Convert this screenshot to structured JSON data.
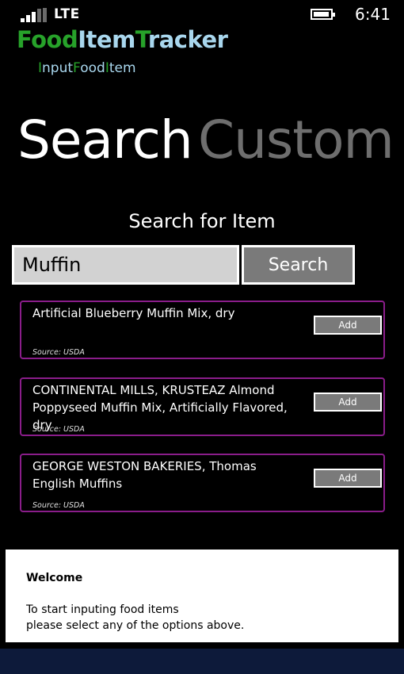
{
  "status_bar": {
    "network": "LTE",
    "time": "6:41",
    "signal_bars_filled": 3,
    "signal_bars_total": 5
  },
  "app": {
    "title_parts": [
      {
        "text": "Food",
        "color": "#27a22a"
      },
      {
        "text": "Item",
        "color": "#a9d7ee"
      },
      {
        "text": "T",
        "color": "#27a22a"
      },
      {
        "text": "racker",
        "color": "#a9d7ee"
      }
    ],
    "subtitle_parts": [
      {
        "text": "I",
        "color": "#27a22a"
      },
      {
        "text": "nput",
        "color": "#a9d7ee"
      },
      {
        "text": "F",
        "color": "#27a22a"
      },
      {
        "text": "ood",
        "color": "#a9d7ee"
      },
      {
        "text": "I",
        "color": "#27a22a"
      },
      {
        "text": "tem",
        "color": "#a9d7ee"
      }
    ]
  },
  "pivot": {
    "active": "Search",
    "inactive": "Custom"
  },
  "search": {
    "label": "Search for Item",
    "value": "Muffin",
    "button": "Search"
  },
  "results": [
    {
      "name": "Artificial Blueberry Muffin Mix, dry",
      "source": "Source: USDA",
      "add_label": "Add"
    },
    {
      "name": "CONTINENTAL MILLS, KRUSTEAZ Almond Poppyseed Muffin Mix, Artificially Flavored, dry",
      "source": "Source: USDA",
      "add_label": "Add"
    },
    {
      "name": "GEORGE WESTON BAKERIES, Thomas English Muffins",
      "source": "Source: USDA",
      "add_label": "Add"
    }
  ],
  "dialog": {
    "title": "Welcome",
    "message": "To start inputing food items\nplease select any of the options above."
  },
  "colors": {
    "accent_green": "#27a22a",
    "accent_light": "#a9d7ee",
    "result_border": "#8a1d8a"
  }
}
